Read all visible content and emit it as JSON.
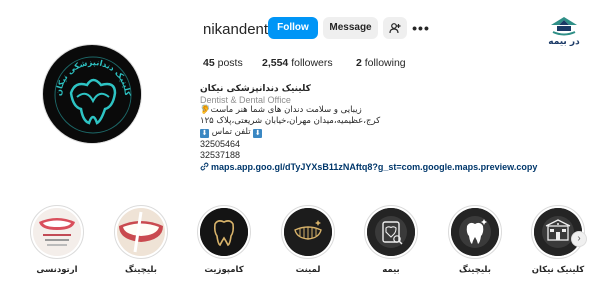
{
  "site": {
    "name": "در بیمه"
  },
  "profile": {
    "username": "nikandent",
    "follow_label": "Follow",
    "message_label": "Message",
    "more_label": "•••",
    "stats": {
      "posts_count": "45",
      "posts_label": "posts",
      "followers_count": "2,554",
      "followers_label": "followers",
      "following_count": "2",
      "following_label": "following"
    },
    "bio": {
      "name": "کلینیک دندانپزشکی نیکان",
      "category": "Dentist & Dental Office",
      "line1": "🦻زیبایی و سلامت دندان های شما هنر ماست",
      "line2": "کرج،عظیمیه،میدان مهران،خیابان شریعتی،پلاک ۱۲۵",
      "line3_icon": "⬇",
      "line3_text": "تلفن تماس",
      "phone1": "32505464",
      "phone2": "32537188",
      "link": "maps.app.goo.gl/dTyJYXsB11zNAftq8?g_st=com.google.maps.preview.copy"
    },
    "avatar_text": "کلینیک دندانپزشکی نیکان"
  },
  "highlights": [
    {
      "label": "ارتودنسی",
      "icon": "orthodontics-photo"
    },
    {
      "label": "بلیچینگ",
      "icon": "bleaching-photo"
    },
    {
      "label": "کامپوزیت",
      "icon": "tooth-icon"
    },
    {
      "label": "لمینت",
      "icon": "laminate-icon"
    },
    {
      "label": "بیمه",
      "icon": "insurance-icon"
    },
    {
      "label": "بلیچینگ",
      "icon": "tooth-sparkle-icon"
    },
    {
      "label": "کلینیک نیکان",
      "icon": "clinic-icon"
    }
  ],
  "colors": {
    "follow": "#0095f6",
    "link": "#00376b",
    "avatar_accent": "#2ec4c4"
  }
}
